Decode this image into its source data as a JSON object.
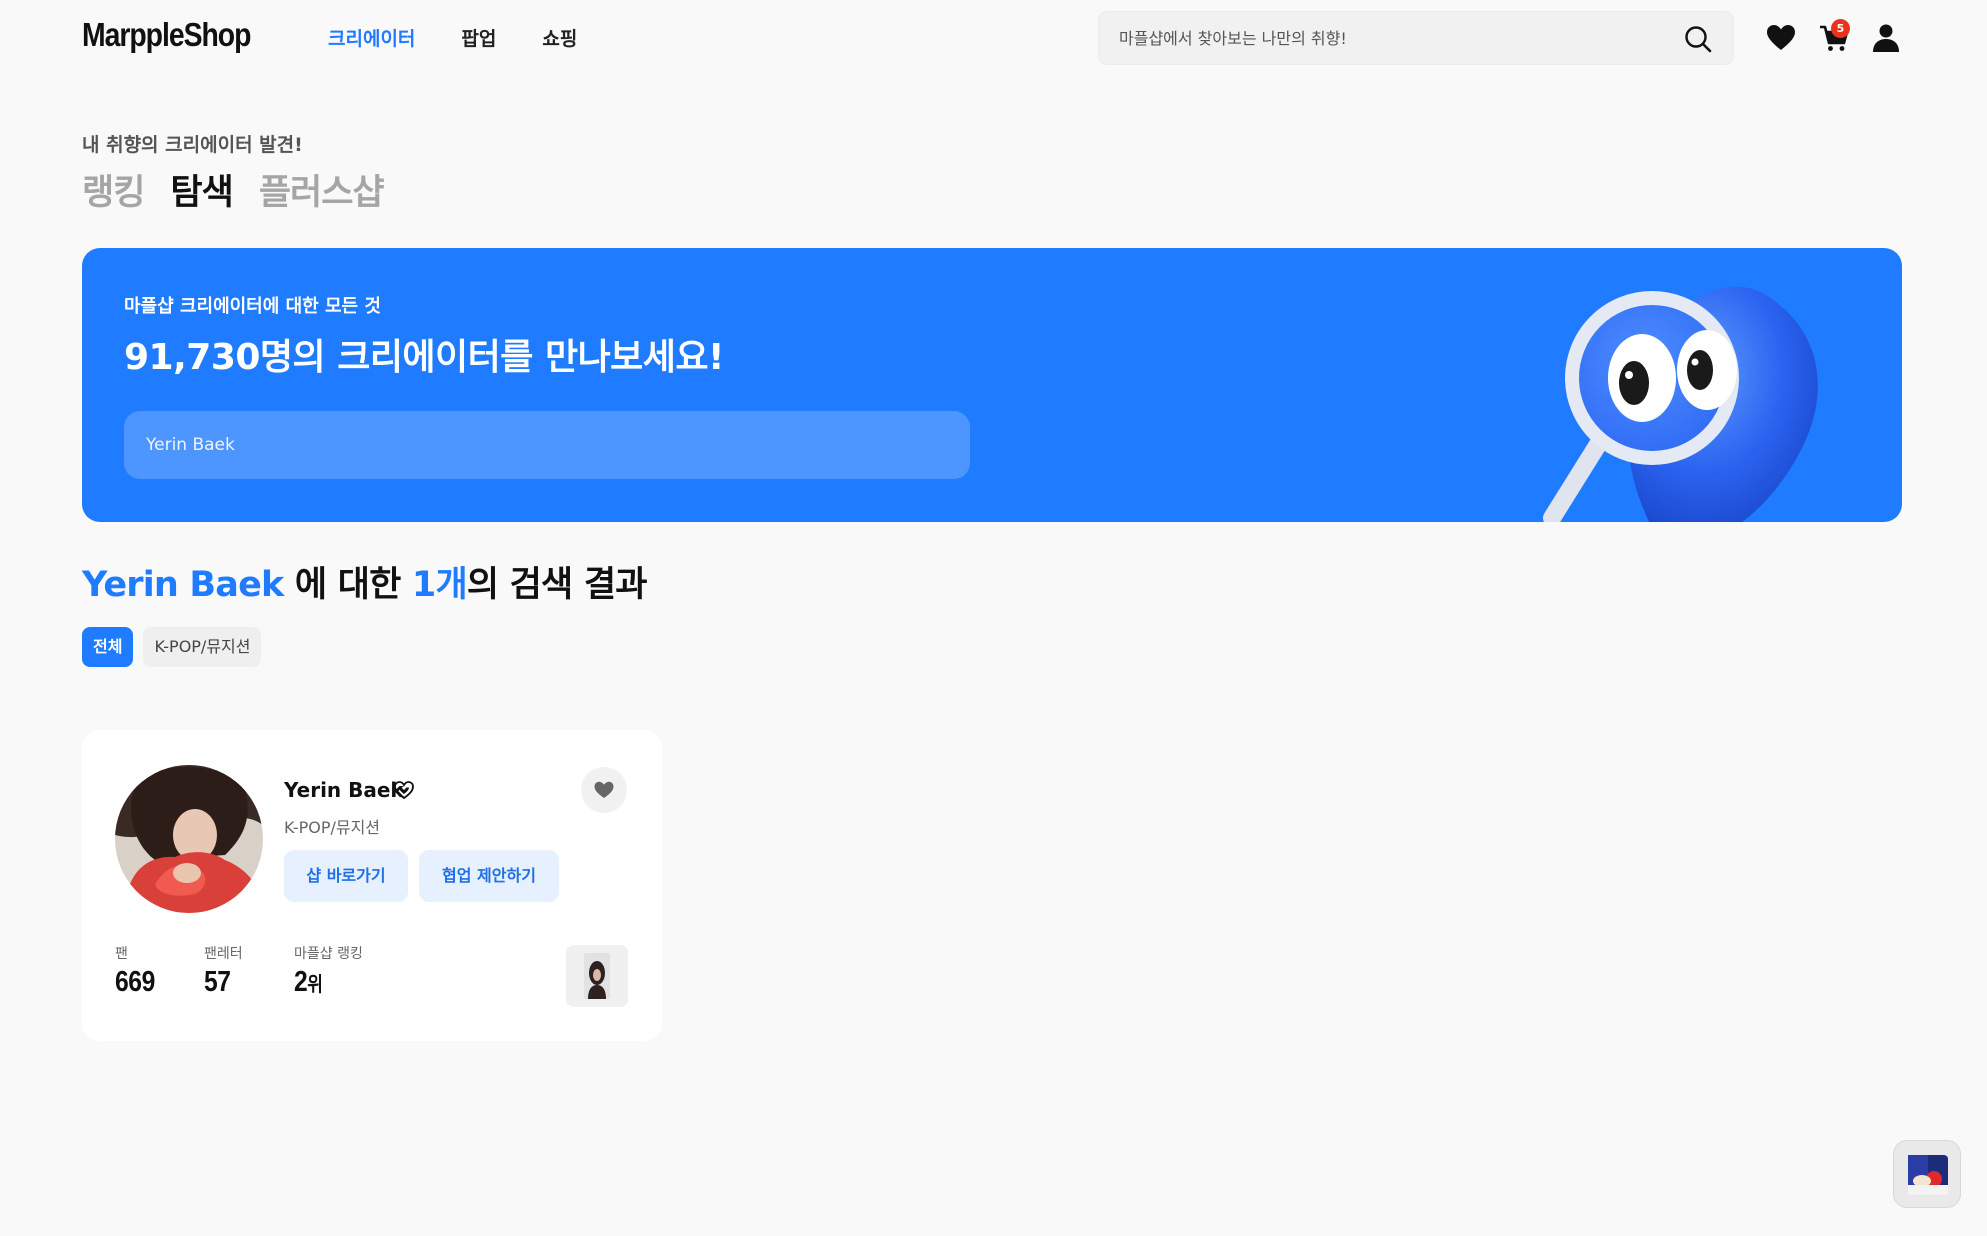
{
  "header": {
    "logo": "MarppleShop",
    "nav": [
      "크리에이터",
      "팝업",
      "쇼핑"
    ],
    "nav_active_index": 0,
    "search_placeholder": "마플샵에서 찾아보는 나만의 취향!",
    "cart_count": "5"
  },
  "section": {
    "kicker": "내 취향의 크리에이터 발견!",
    "tabs": [
      "랭킹",
      "탐색",
      "플러스샵"
    ],
    "active_tab_index": 1
  },
  "banner": {
    "kicker": "마플샵 크리에이터에 대한 모든 것",
    "title": "91,730명의 크리에이터를 만나보세요!",
    "search_value": "Yerin Baek"
  },
  "results": {
    "query": "Yerin Baek",
    "mid_text": " 에 대한 ",
    "count": "1개",
    "suffix": "의 검색 결과",
    "filters": [
      "전체",
      "K-POP/뮤지션"
    ],
    "active_filter_index": 0
  },
  "creator_card": {
    "name": "Yerin Baek",
    "category": "K-POP/뮤지션",
    "shop_button": "샵 바로가기",
    "collab_button": "협업 제안하기",
    "stats": [
      {
        "label": "팬",
        "value": "669",
        "unit": ""
      },
      {
        "label": "팬레터",
        "value": "57",
        "unit": ""
      },
      {
        "label": "마플샵 랭킹",
        "value": "2",
        "unit": "위"
      }
    ]
  },
  "colors": {
    "accent": "#1f7bff",
    "banner": "#1f7bff",
    "badge": "#e8341d"
  }
}
